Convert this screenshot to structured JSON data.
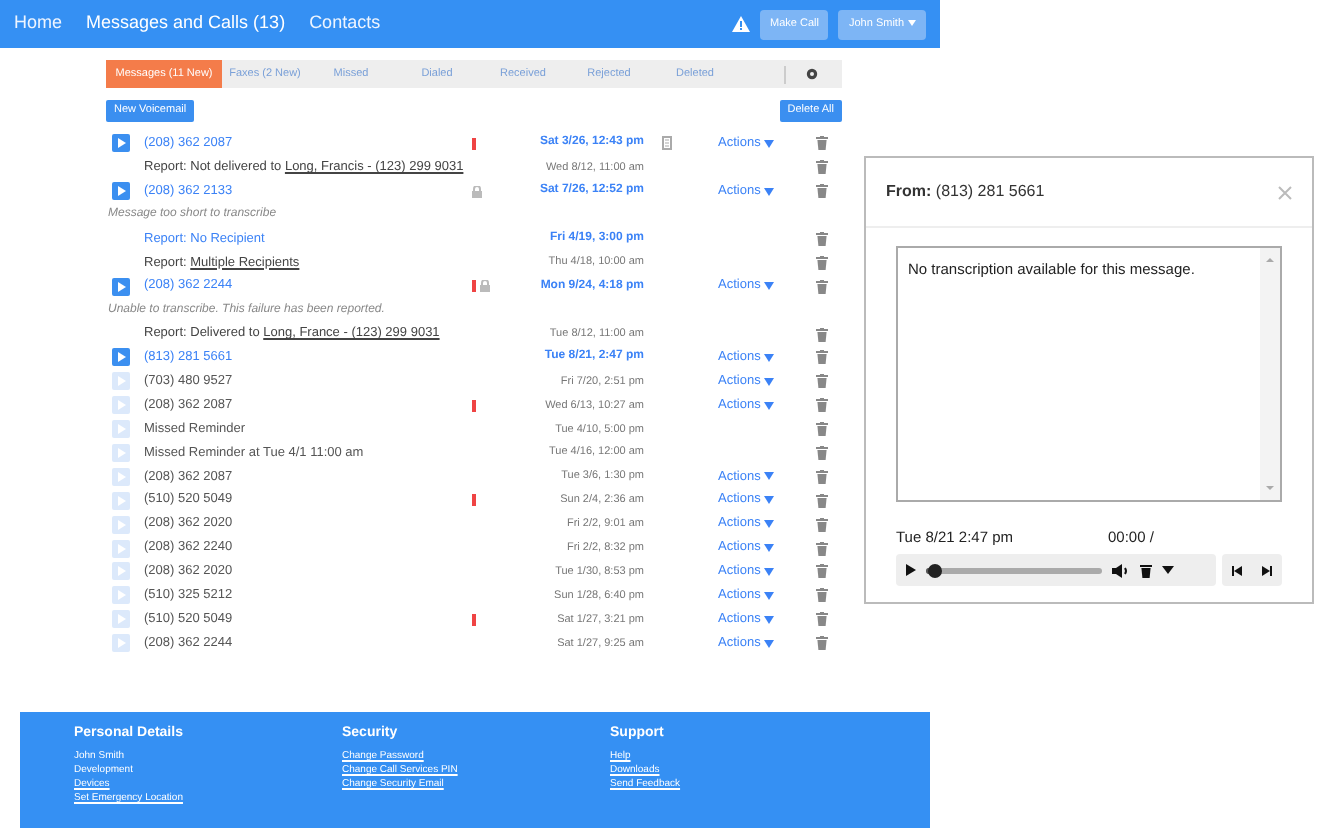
{
  "nav": {
    "links": [
      {
        "label": "Home",
        "selected": false
      },
      {
        "label": "Messages and Calls (13)",
        "selected": true
      },
      {
        "label": "Contacts",
        "selected": false
      }
    ],
    "make_call": "Make Call",
    "user": "John Smith"
  },
  "tabs": [
    {
      "label": "Messages (11 New)",
      "selected": true
    },
    {
      "label": "Faxes (2 New)",
      "selected": false
    },
    {
      "label": "Missed",
      "selected": false
    },
    {
      "label": "Dialed",
      "selected": false
    },
    {
      "label": "Received",
      "selected": false
    },
    {
      "label": "Rejected",
      "selected": false
    },
    {
      "label": "Deleted",
      "selected": false
    }
  ],
  "new_voicemail": "New Voicemail",
  "delete_all": "Delete All",
  "rows": [
    {
      "kind": "call",
      "number": "(208) 362 2087",
      "unread": true,
      "alert": true,
      "locked": false,
      "attachment": true,
      "date": "Sat 3/26, 12:43 pm",
      "actions": "Actions"
    },
    {
      "kind": "report",
      "text": "Report: Not delivered to ",
      "link": "Long, Francis - (123) 299 9031",
      "unread": false,
      "date": "Wed 8/12, 11:00 am"
    },
    {
      "kind": "call",
      "number": "(208) 362 2133",
      "unread": true,
      "alert": false,
      "locked": true,
      "attachment": false,
      "date": "Sat 7/26, 12:52 pm",
      "actions": "Actions"
    },
    {
      "kind": "note",
      "text": "Message too short to transcribe"
    },
    {
      "kind": "report",
      "text": "Report: No Recipient",
      "unread": true,
      "date": "Fri 4/19, 3:00 pm"
    },
    {
      "kind": "report",
      "text": "Report: ",
      "link": "Multiple Recipients",
      "unread": false,
      "date": "Thu 4/18, 10:00 am"
    },
    {
      "kind": "call",
      "number": "(208) 362 2244",
      "unread": true,
      "alert": true,
      "locked": true,
      "attachment": false,
      "date": "Mon 9/24, 4:18 pm",
      "actions": "Actions"
    },
    {
      "kind": "note",
      "text": "Unable to transcribe. This failure has been reported."
    },
    {
      "kind": "report",
      "text": "Report: Delivered to ",
      "link": "Long, France - (123) 299 9031",
      "unread": false,
      "date": "Tue 8/12, 11:00 am"
    },
    {
      "kind": "call",
      "number": "(813) 281 5661",
      "unread": true,
      "alert": false,
      "locked": false,
      "attachment": false,
      "date": "Tue 8/21, 2:47 pm",
      "actions": "Actions"
    },
    {
      "kind": "call",
      "number": "(703) 480 9527",
      "unread": false,
      "alert": false,
      "locked": false,
      "attachment": false,
      "date": "Fri 7/20, 2:51 pm",
      "actions": "Actions"
    },
    {
      "kind": "call",
      "number": "(208) 362 2087",
      "unread": false,
      "alert": true,
      "locked": false,
      "attachment": false,
      "date": "Wed 6/13, 10:27 am",
      "actions": "Actions"
    },
    {
      "kind": "call",
      "number": "Missed Reminder",
      "unread": false,
      "alert": false,
      "locked": false,
      "attachment": false,
      "date": "Tue 4/10, 5:00 pm"
    },
    {
      "kind": "call",
      "number": "Missed Reminder at Tue 4/1 11:00 am",
      "unread": false,
      "alert": false,
      "locked": false,
      "attachment": false,
      "date": "Tue 4/16, 12:00 am"
    },
    {
      "kind": "call",
      "number": "(208) 362 2087",
      "unread": false,
      "alert": false,
      "locked": false,
      "attachment": false,
      "date": "Tue 3/6, 1:30 pm",
      "actions": "Actions"
    },
    {
      "kind": "call",
      "number": "(510) 520 5049",
      "unread": false,
      "alert": true,
      "locked": false,
      "attachment": false,
      "date": "Sun 2/4, 2:36 am",
      "actions": "Actions"
    },
    {
      "kind": "call",
      "number": "(208) 362 2020",
      "unread": false,
      "alert": false,
      "locked": false,
      "attachment": false,
      "date": "Fri 2/2, 9:01 am",
      "actions": "Actions"
    },
    {
      "kind": "call",
      "number": "(208) 362 2240",
      "unread": false,
      "alert": false,
      "locked": false,
      "attachment": false,
      "date": "Fri 2/2, 8:32 pm",
      "actions": "Actions"
    },
    {
      "kind": "call",
      "number": "(208) 362 2020",
      "unread": false,
      "alert": false,
      "locked": false,
      "attachment": false,
      "date": "Tue 1/30, 8:53 pm",
      "actions": "Actions"
    },
    {
      "kind": "call",
      "number": "(510) 325 5212",
      "unread": false,
      "alert": false,
      "locked": false,
      "attachment": false,
      "date": "Sun 1/28, 6:40 pm",
      "actions": "Actions"
    },
    {
      "kind": "call",
      "number": "(510) 520 5049",
      "unread": false,
      "alert": true,
      "locked": false,
      "attachment": false,
      "date": "Sat 1/27, 3:21 pm",
      "actions": "Actions"
    },
    {
      "kind": "call",
      "number": "(208) 362 2244",
      "unread": false,
      "alert": false,
      "locked": false,
      "attachment": false,
      "date": "Sat 1/27, 9:25 am",
      "actions": "Actions"
    }
  ],
  "footer": [
    {
      "heading": "Personal Details",
      "items": [
        {
          "label": "John Smith",
          "link": false
        },
        {
          "label": "Development",
          "link": false
        },
        {
          "label": "Devices",
          "link": true
        },
        {
          "label": "Set Emergency Location",
          "link": true
        }
      ]
    },
    {
      "heading": "Security",
      "items": [
        {
          "label": "Change Password",
          "link": true
        },
        {
          "label": "Change Call Services PIN",
          "link": true
        },
        {
          "label": "Change Security Email",
          "link": true
        }
      ]
    },
    {
      "heading": "Support",
      "items": [
        {
          "label": "Help",
          "link": true
        },
        {
          "label": "Downloads",
          "link": true
        },
        {
          "label": "Send Feedback",
          "link": true
        }
      ]
    }
  ],
  "panel": {
    "from_label": "From:",
    "from": "(813) 281 5661",
    "transcription": "No transcription available for this message.",
    "date": "Tue 8/21 2:47 pm",
    "time": "00:00 /",
    "progress": {
      "level": 0.04
    }
  }
}
